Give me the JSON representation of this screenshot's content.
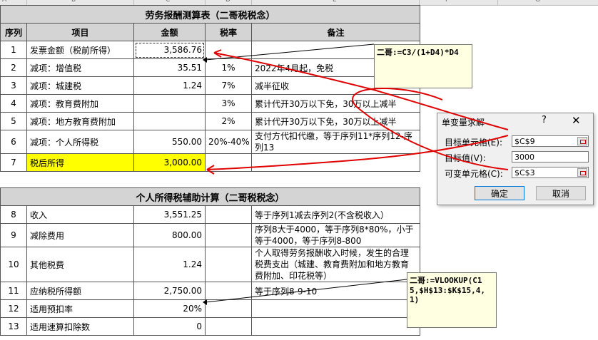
{
  "col_letters": [
    "A",
    "B",
    "C",
    "D",
    "E",
    "F",
    "G"
  ],
  "table1": {
    "title": "劳务报酬测算表（二哥税税念）",
    "headers": [
      "序列",
      "项目",
      "金额",
      "税率",
      "备注"
    ],
    "rows": [
      {
        "seq": "1",
        "item": "发票金额（税前所得）",
        "amount": "3,586.76",
        "rate": "",
        "note": ""
      },
      {
        "seq": "2",
        "item": "减项：增值税",
        "amount": "35.51",
        "rate": "1%",
        "note": "2022年4月起，免税"
      },
      {
        "seq": "3",
        "item": "减项：城建税",
        "amount": "1.24",
        "rate": "7%",
        "note": "减半征收"
      },
      {
        "seq": "4",
        "item": "减项：教育费附加",
        "amount": "",
        "rate": "3%",
        "note": "累计代开30万以下免，30万以上减半"
      },
      {
        "seq": "5",
        "item": "减项：地方教育费附加",
        "amount": "",
        "rate": "2%",
        "note": "累计代开30万以下免，30万以上减半"
      },
      {
        "seq": "6",
        "item": "减项：个人所得税",
        "amount": "550.00",
        "rate": "20%-40%",
        "note": "支付方代扣代缴，等于序列11*序列12-序列13"
      },
      {
        "seq": "7",
        "item": "税后所得",
        "amount": "3,000.00",
        "rate": "",
        "note": ""
      }
    ]
  },
  "table2": {
    "title": "个人所得税辅助计算（二哥税税念）",
    "rows": [
      {
        "seq": "8",
        "item": "收入",
        "amount": "3,551.25",
        "rate": "",
        "note": "等于序列1减去序列2(不含税收入）"
      },
      {
        "seq": "9",
        "item": "减除费用",
        "amount": "800.00",
        "rate": "",
        "note": "序列8大于4000，等于序列8*80%，小于等于4000，等于序列8-800"
      },
      {
        "seq": "10",
        "item": "其他税费",
        "amount": "1.24",
        "rate": "",
        "note": "个人取得劳务报酬收入时候，发生的合理税费支出（城建、教育费附加和地方教育费附加、印花税等）"
      },
      {
        "seq": "11",
        "item": "应纳税所得额",
        "amount": "2,750.00",
        "rate": "",
        "note": "等于序列8-9-10"
      },
      {
        "seq": "12",
        "item": "适用预扣率",
        "amount": "20%",
        "rate": "",
        "note": ""
      },
      {
        "seq": "13",
        "item": "适用速算扣除数",
        "amount": "0",
        "rate": "",
        "note": ""
      }
    ]
  },
  "comments": {
    "c1": "二哥:=C3/(1+D4)*D4",
    "c2": "二哥:=VLOOKUP(C15,$H$13:$K$15,4,1)"
  },
  "dialog": {
    "title": "单变量求解",
    "help": "?",
    "close": "✕",
    "target_cell_label": "目标单元格(E):",
    "target_cell_value": "$C$9",
    "target_value_label": "目标值(V):",
    "target_value_value": "3000",
    "changing_cell_label": "可变单元格(C):",
    "changing_cell_value": "$C$3",
    "ok_label": "确定",
    "cancel_label": "取消"
  },
  "colors": {
    "header_fill": "#d4d4d4",
    "highlight": "#ffff00",
    "ink": "#e00000"
  }
}
